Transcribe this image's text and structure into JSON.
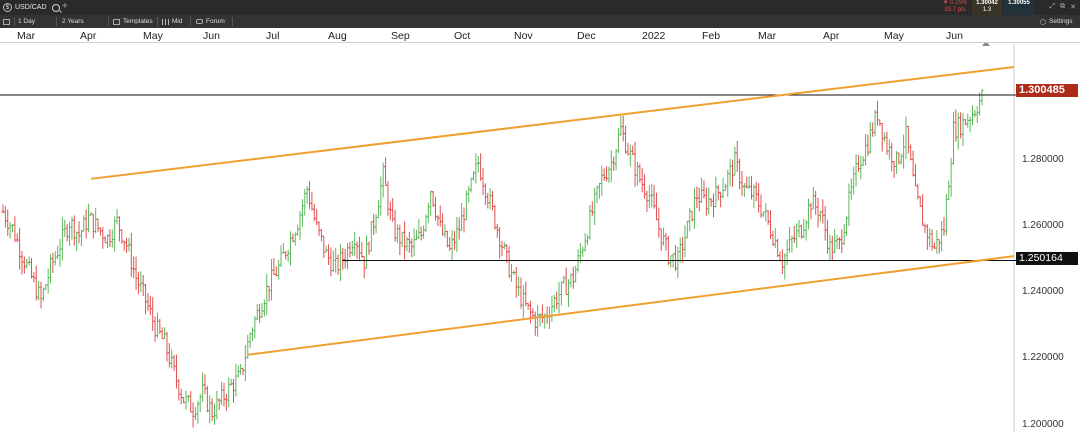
{
  "topbar": {
    "symbol": "USD/CAD",
    "change_pct": "▼ 0.25%",
    "change_pips": "33.7 pts",
    "bid": "1.30042",
    "bid_sub": "",
    "ask": "1.30055",
    "spread": "1.3"
  },
  "toolbar": {
    "timeframe": "1 Day",
    "range": "2 Years",
    "templates": "Templates",
    "price_type": "Mid",
    "forum": "Forum",
    "settings": "Settings"
  },
  "months": [
    "Mar",
    "Apr",
    "May",
    "Jun",
    "Jul",
    "Aug",
    "Sep",
    "Oct",
    "Nov",
    "Dec",
    "2022",
    "Feb",
    "Mar",
    "Apr",
    "May",
    "Jun"
  ],
  "price_tags": {
    "current": "1.300485",
    "support": "1.250164"
  },
  "y_ticks": [
    "1.280000",
    "1.260000",
    "1.240000",
    "1.220000",
    "1.200000"
  ],
  "chart_data": {
    "type": "ohlc",
    "instrument": "USD/CAD",
    "ylim": [
      1.198,
      1.316
    ],
    "colors": {
      "up": "#5cb85c",
      "down": "#e05050",
      "trendline": "#f0a030",
      "hline": "#111111"
    },
    "horizontal_lines": [
      1.300485,
      1.250164
    ],
    "trendlines": [
      {
        "from": [
          "Apr 2021",
          1.275
        ],
        "to": [
          "Jun 2022",
          1.309
        ]
      },
      {
        "from": [
          "Jul 2021",
          1.2215
        ],
        "to": [
          "Jun 2022",
          1.2515
        ]
      }
    ],
    "series_close": [
      1.265,
      1.26,
      1.252,
      1.245,
      1.238,
      1.248,
      1.255,
      1.262,
      1.258,
      1.263,
      1.26,
      1.257,
      1.262,
      1.255,
      1.245,
      1.238,
      1.23,
      1.225,
      1.216,
      1.208,
      1.205,
      1.21,
      1.204,
      1.208,
      1.212,
      1.215,
      1.228,
      1.236,
      1.243,
      1.248,
      1.255,
      1.262,
      1.272,
      1.26,
      1.252,
      1.248,
      1.252,
      1.258,
      1.25,
      1.262,
      1.276,
      1.26,
      1.256,
      1.254,
      1.258,
      1.272,
      1.26,
      1.253,
      1.26,
      1.27,
      1.28,
      1.27,
      1.26,
      1.25,
      1.242,
      1.236,
      1.232,
      1.233,
      1.238,
      1.242,
      1.245,
      1.255,
      1.265,
      1.275,
      1.28,
      1.29,
      1.282,
      1.275,
      1.27,
      1.26,
      1.252,
      1.25,
      1.26,
      1.27,
      1.268,
      1.27,
      1.274,
      1.28,
      1.272,
      1.27,
      1.265,
      1.258,
      1.25,
      1.256,
      1.26,
      1.268,
      1.265,
      1.254,
      1.255,
      1.268,
      1.28,
      1.286,
      1.295,
      1.285,
      1.28,
      1.288,
      1.27,
      1.26,
      1.254,
      1.26,
      1.29,
      1.292,
      1.295,
      1.3
    ]
  }
}
